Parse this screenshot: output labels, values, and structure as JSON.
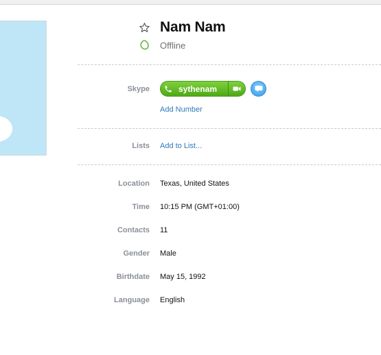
{
  "profile": {
    "name": "Nam Nam",
    "status": "Offline"
  },
  "skype": {
    "label": "Skype",
    "username": "sythenam",
    "add_number": "Add Number"
  },
  "lists": {
    "label": "Lists",
    "add_to_list": "Add to List..."
  },
  "details": [
    {
      "label": "Location",
      "value": "Texas, United States"
    },
    {
      "label": "Time",
      "value": "10:15 PM (GMT+01:00)"
    },
    {
      "label": "Contacts",
      "value": "11"
    },
    {
      "label": "Gender",
      "value": "Male"
    },
    {
      "label": "Birthdate",
      "value": "May 15, 1992"
    },
    {
      "label": "Language",
      "value": "English"
    }
  ],
  "colors": {
    "call_green": "#5cb820",
    "link_blue": "#2e79b9",
    "status_green": "#59b62e",
    "chat_blue": "#3a9fe8"
  },
  "icons": [
    "star-icon",
    "status-offline-icon",
    "phone-icon",
    "video-icon",
    "chat-icon"
  ]
}
